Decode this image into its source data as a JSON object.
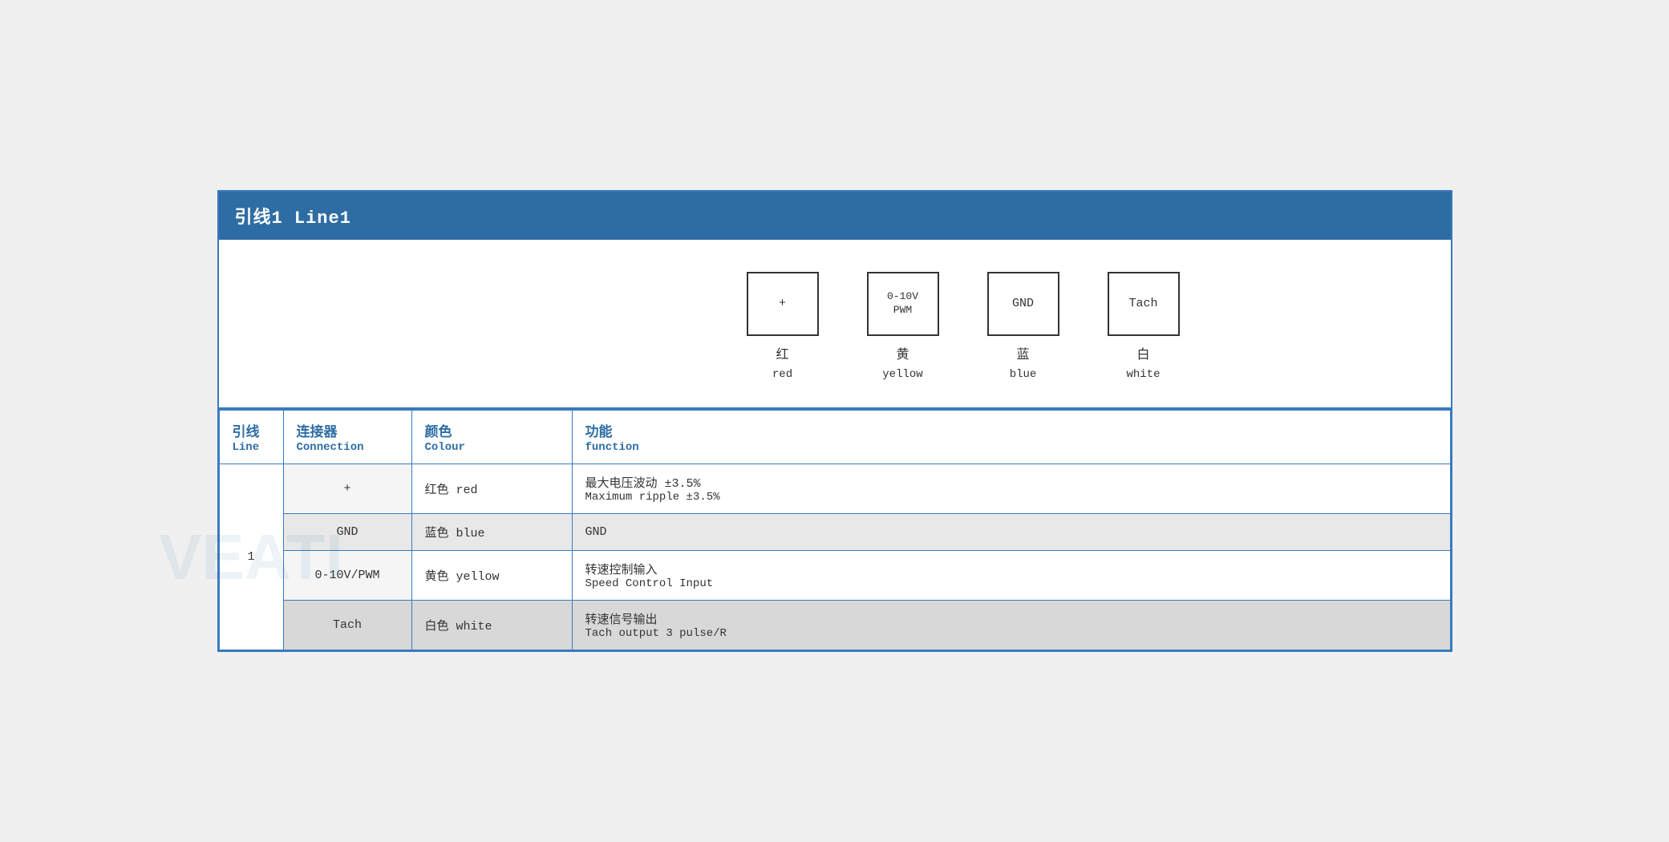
{
  "title": "引线1 Line1",
  "diagram": {
    "connectors": [
      {
        "symbol": "+",
        "zh": "红",
        "en": "red"
      },
      {
        "symbol": "0-10V\nPWM",
        "zh": "黄",
        "en": "yellow"
      },
      {
        "symbol": "GND",
        "zh": "蓝",
        "en": "blue"
      },
      {
        "symbol": "Tach",
        "zh": "白",
        "en": "white"
      }
    ]
  },
  "table": {
    "headers": {
      "line_zh": "引线",
      "line_en": "Line",
      "conn_zh": "连接器",
      "conn_en": "Connection",
      "color_zh": "颜色",
      "color_en": "Colour",
      "func_zh": "功能",
      "func_en": "function"
    },
    "rows": [
      {
        "line": "1",
        "connector": "+",
        "color_zh": "红色 red",
        "func_zh": "最大电压波动 ±3.5%",
        "func_en": "Maximum ripple ±3.5%",
        "bg": "white"
      },
      {
        "line": "1",
        "connector": "GND",
        "color_zh": "蓝色 blue",
        "func_zh": "GND",
        "func_en": "",
        "bg": "gray1"
      },
      {
        "line": "1",
        "connector": "0-10V/PWM",
        "color_zh": "黄色 yellow",
        "func_zh": "转速控制输入",
        "func_en": "Speed Control Input",
        "bg": "white"
      },
      {
        "line": "1",
        "connector": "Tach",
        "color_zh": "白色 white",
        "func_zh": "转速信号输出",
        "func_en": "Tach output 3 pulse/R",
        "bg": "gray2"
      }
    ]
  }
}
